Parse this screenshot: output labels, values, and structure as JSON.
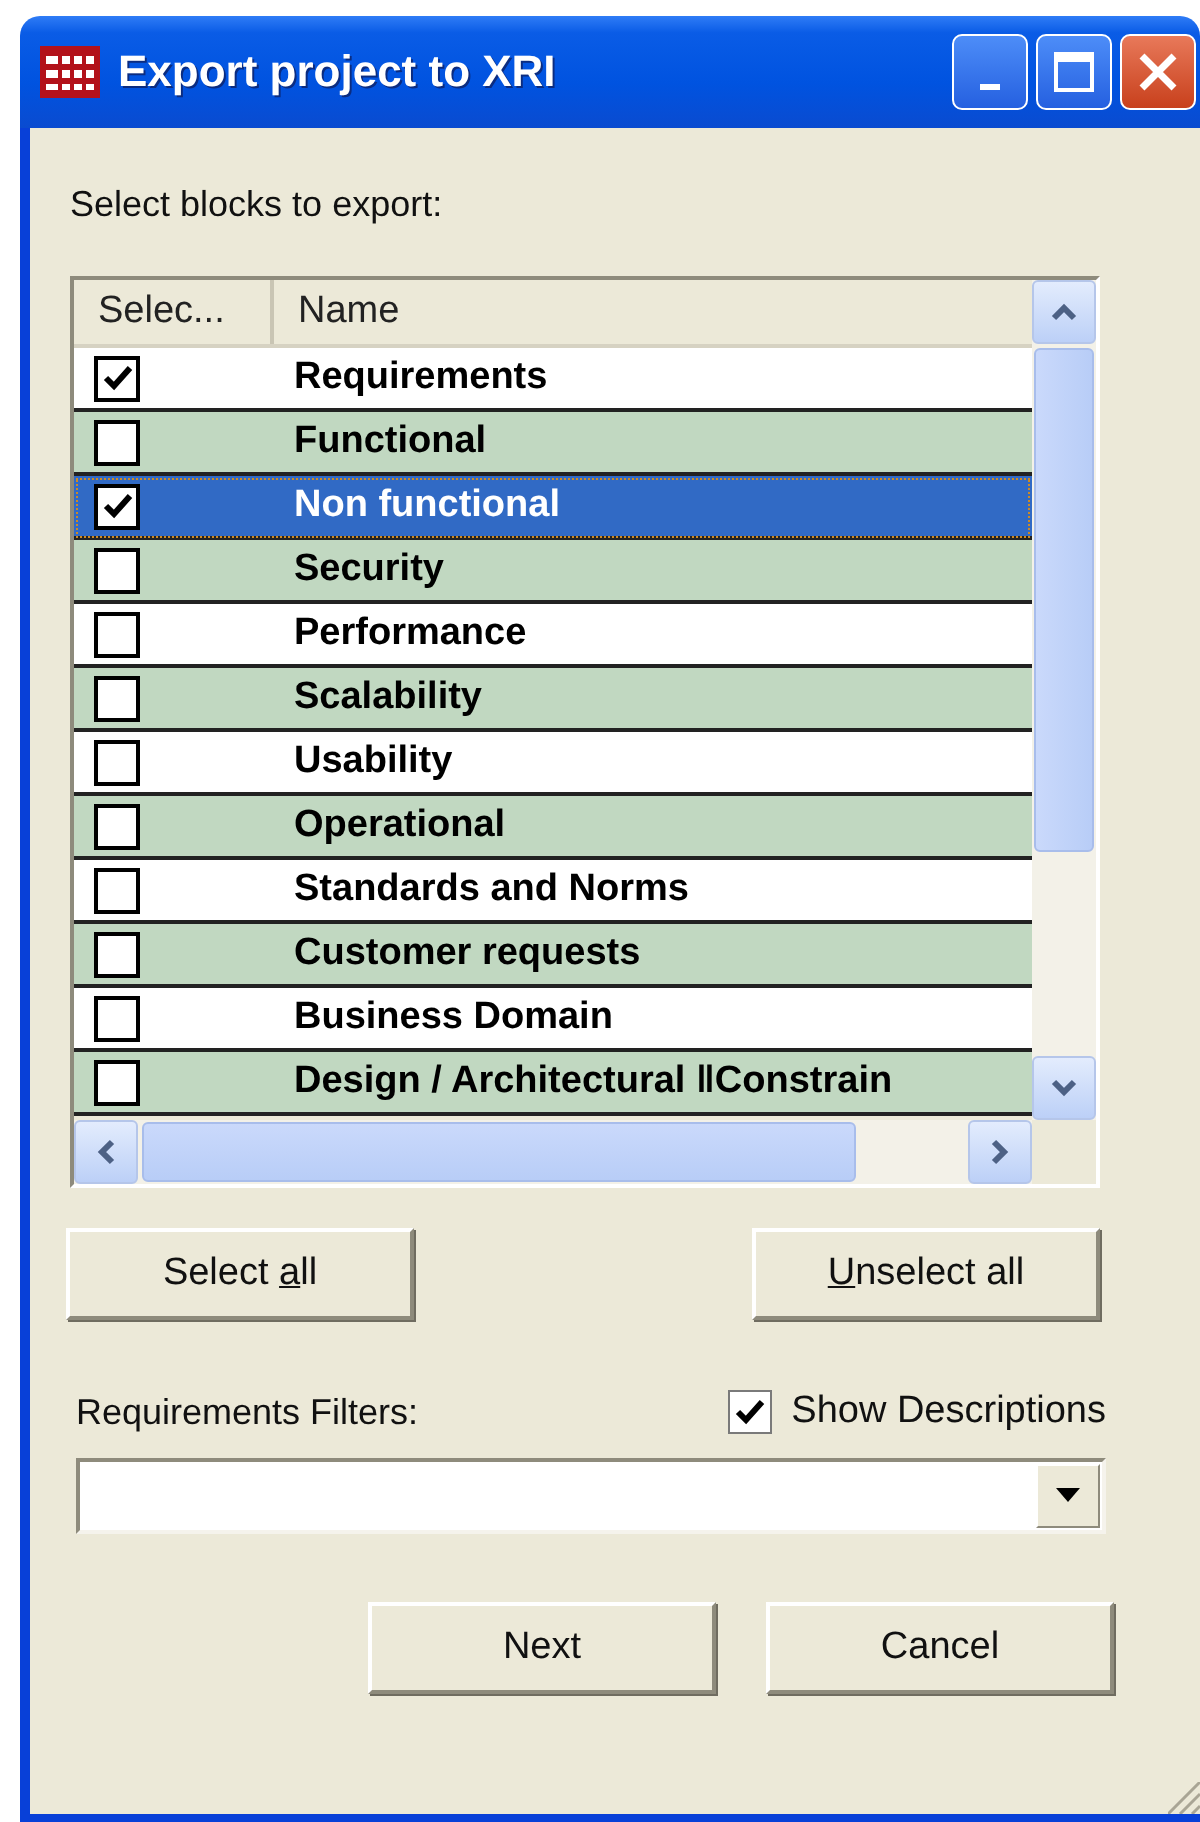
{
  "window": {
    "title": "Export project to XRI"
  },
  "prompt": "Select blocks to export:",
  "table": {
    "columns": [
      "Selec...",
      "Name"
    ],
    "rows": [
      {
        "name": "Requirements",
        "checked": true,
        "selected": false
      },
      {
        "name": "Functional",
        "checked": false,
        "selected": false
      },
      {
        "name": "Non functional",
        "checked": true,
        "selected": true
      },
      {
        "name": "Security",
        "checked": false,
        "selected": false
      },
      {
        "name": "Performance",
        "checked": false,
        "selected": false
      },
      {
        "name": "Scalability",
        "checked": false,
        "selected": false
      },
      {
        "name": "Usability",
        "checked": false,
        "selected": false
      },
      {
        "name": "Operational",
        "checked": false,
        "selected": false
      },
      {
        "name": "Standards and Norms",
        "checked": false,
        "selected": false
      },
      {
        "name": "Customer requests",
        "checked": false,
        "selected": false
      },
      {
        "name": "Business Domain",
        "checked": false,
        "selected": false
      },
      {
        "name": "Design / Architectural ‖Constrain",
        "checked": false,
        "selected": false
      }
    ]
  },
  "select_buttons": [
    {
      "label": [
        {
          "text": "Select "
        },
        {
          "text": "a",
          "underline": true
        },
        {
          "text": "ll"
        }
      ]
    },
    {
      "label": [
        {
          "text": "U",
          "underline": true
        },
        {
          "text": "nselect all"
        }
      ]
    }
  ],
  "filters": {
    "label": "Requirements Filters:",
    "show_descriptions": {
      "label": "Show Descriptions",
      "checked": true
    }
  },
  "dialog_buttons": [
    {
      "label": [
        {
          "text": "Next"
        }
      ]
    },
    {
      "label": [
        {
          "text": "Cancel"
        }
      ]
    }
  ]
}
